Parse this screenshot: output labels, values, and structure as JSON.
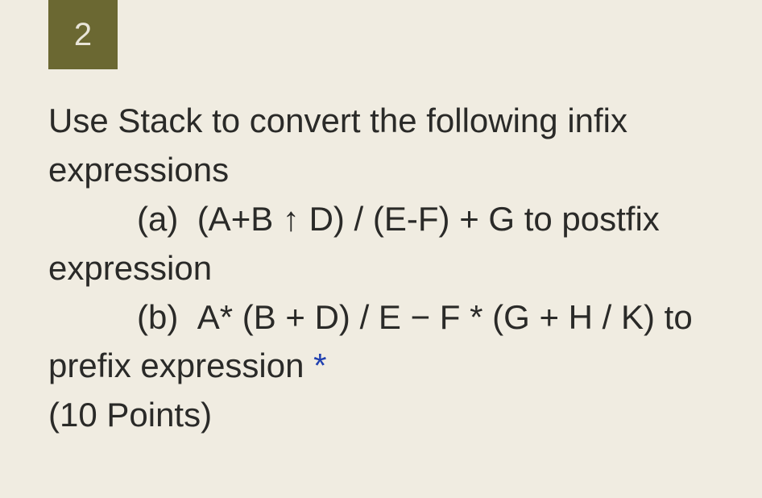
{
  "question": {
    "number": "2",
    "intro": "Use Stack to convert the following infix expressions",
    "part_a_label": "(a)",
    "part_a_expr": "(A+B ↑ D) / (E-F) + G to postfix expression",
    "part_b_label": "(b)",
    "part_b_expr": "A* (B + D) / E − F * (G + H / K) to prefix expression",
    "required_indicator": "*",
    "points": "(10 Points)"
  }
}
